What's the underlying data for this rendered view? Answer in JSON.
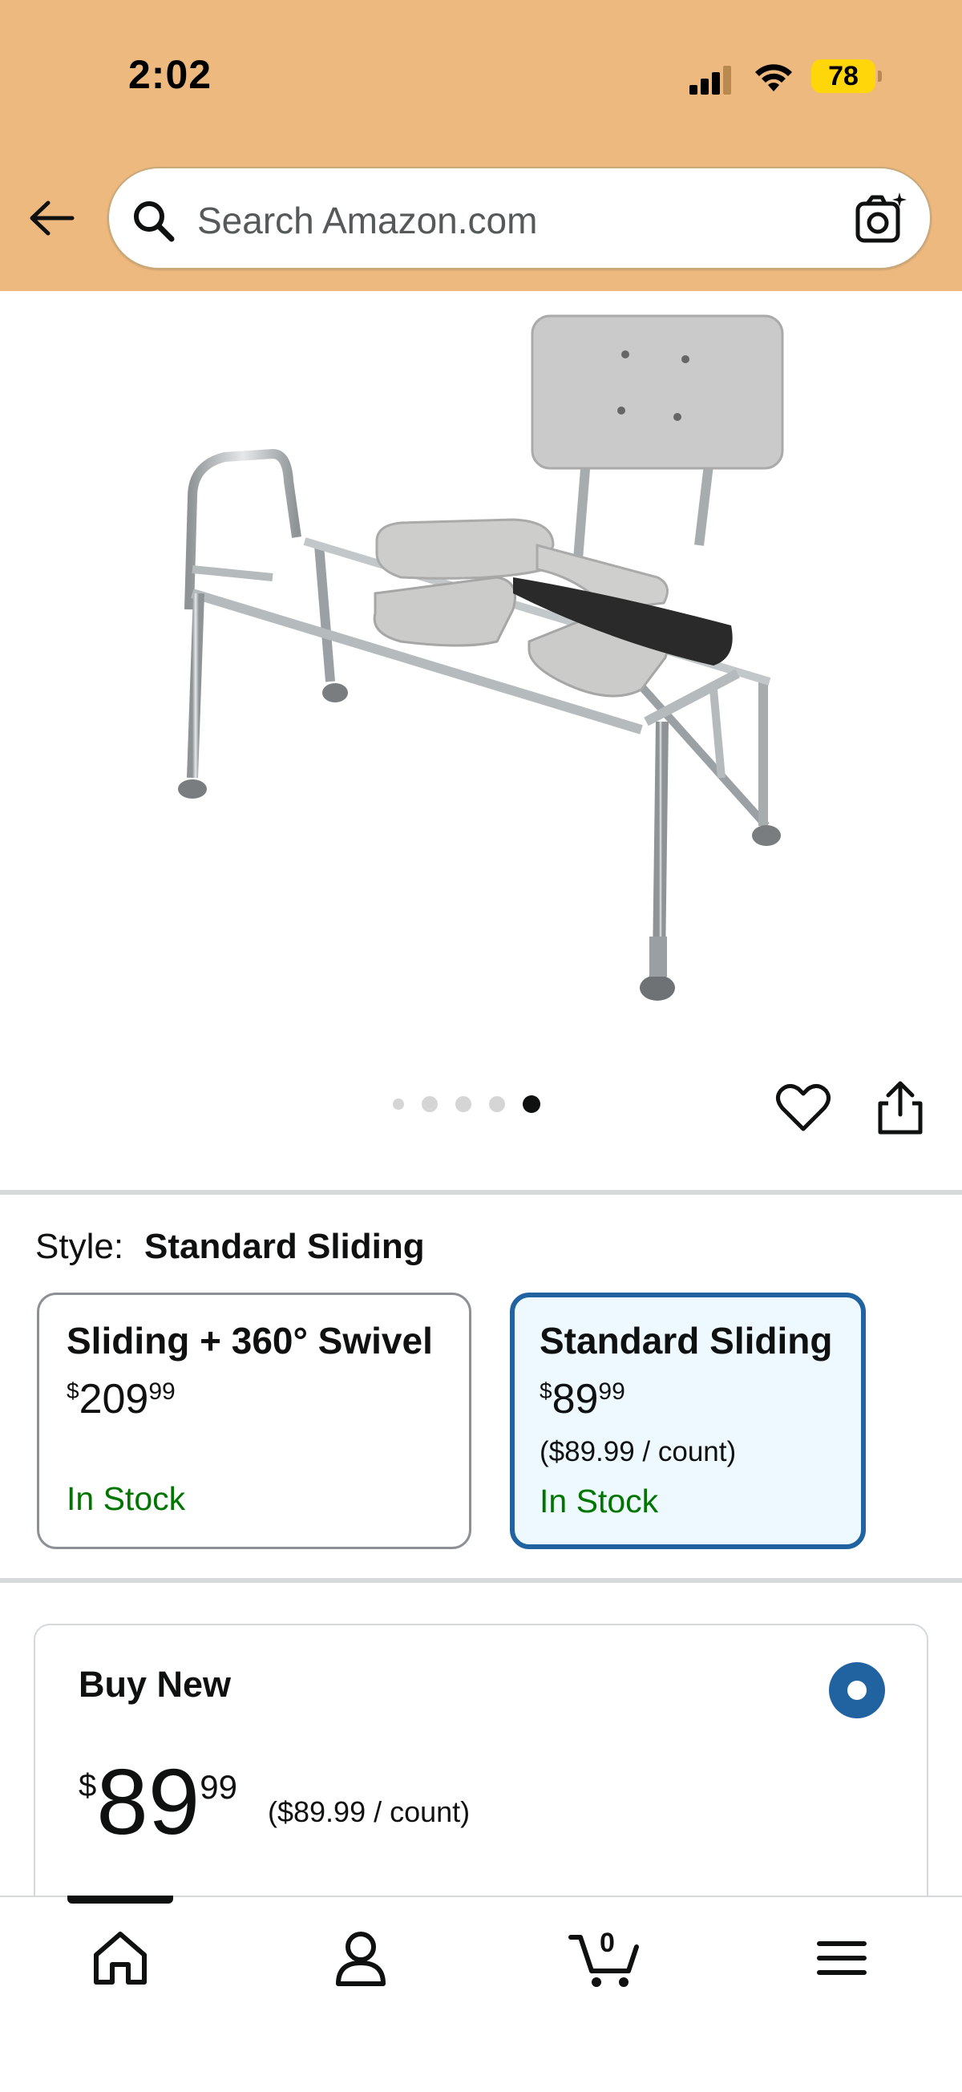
{
  "status_bar": {
    "time": "2:02",
    "battery": "78"
  },
  "search": {
    "placeholder": "Search Amazon.com"
  },
  "gallery": {
    "image_count": 5,
    "active_index": 5
  },
  "style": {
    "label": "Style:",
    "selected": "Standard Sliding",
    "options": [
      {
        "title": "Sliding + 360° Swivel",
        "currency": "$",
        "price_whole": "209",
        "price_fraction": "99",
        "unit_price": "",
        "stock": "In Stock",
        "selected": false
      },
      {
        "title": "Standard Sliding",
        "currency": "$",
        "price_whole": "89",
        "price_fraction": "99",
        "unit_price": "($89.99 / count)",
        "stock": "In Stock",
        "selected": true
      }
    ]
  },
  "buy_new": {
    "title": "Buy New",
    "currency": "$",
    "price_whole": "89",
    "price_fraction": "99",
    "unit_price": "($89.99 / count)"
  },
  "bottom_nav": {
    "cart_count": "0"
  },
  "colors": {
    "header_bg": "#edb97f",
    "selected_border": "#2162a1",
    "selected_bg": "#edf8ff",
    "in_stock": "#007600",
    "battery": "#ffd60a"
  }
}
